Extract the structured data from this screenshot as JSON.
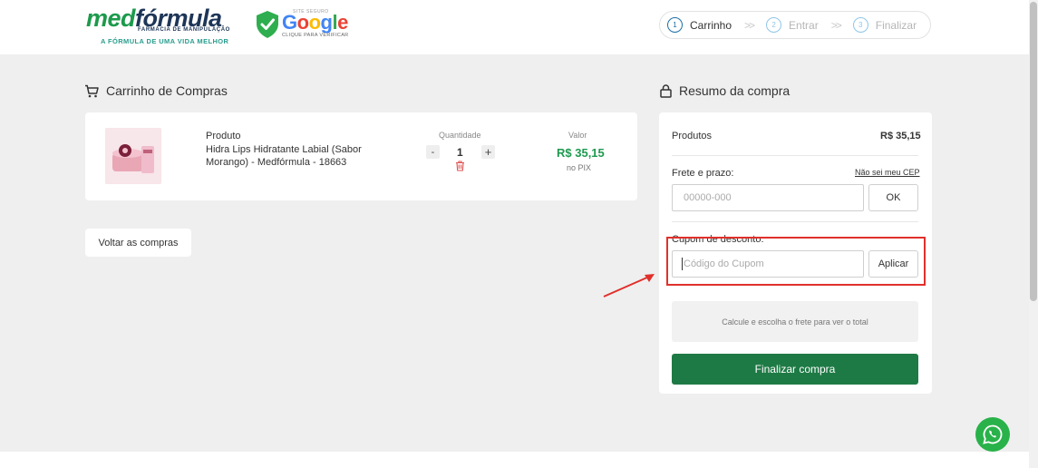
{
  "header": {
    "logo": {
      "word_part1": "med",
      "word_part2": "fórmula",
      "tagline_top": "FARMÁCIA DE MANIPULAÇÃO",
      "tagline_bottom": "A FÓRMULA DE UMA VIDA MELHOR"
    },
    "security_badge": {
      "small": "SITE SEGURO",
      "brand_letters": [
        "G",
        "o",
        "o",
        "g",
        "l",
        "e"
      ],
      "cta": "CLIQUE PARA VERIFICAR"
    },
    "steps": [
      {
        "num": "1",
        "label": "Carrinho",
        "active": true
      },
      {
        "num": "2",
        "label": "Entrar",
        "active": false
      },
      {
        "num": "3",
        "label": "Finalizar",
        "active": false
      }
    ],
    "step_separator": ">>"
  },
  "cart": {
    "title": "Carrinho de Compras",
    "product_label": "Produto",
    "product_name": "Hidra Lips Hidratante Labial (Sabor Morango) - Medfórmula - 18663",
    "qty_label": "Quantidade",
    "qty_minus": "-",
    "qty_value": "1",
    "qty_plus": "+",
    "value_label": "Valor",
    "price": "R$ 35,15",
    "price_note": "no PIX",
    "back_button": "Voltar as compras"
  },
  "summary": {
    "title": "Resumo da compra",
    "products_label": "Produtos",
    "products_value": "R$ 35,15",
    "shipping_label": "Frete e prazo:",
    "cep_link": "Não sei meu CEP",
    "cep_placeholder": "00000-000",
    "cep_button": "OK",
    "coupon_label": "Cupom de desconto:",
    "coupon_placeholder": "Código do Cupom",
    "coupon_button": "Aplicar",
    "calc_note": "Calcule e escolha o frete para ver o total",
    "finalize_button": "Finalizar compra"
  },
  "colors": {
    "brand_green": "#1d9a4c",
    "brand_navy": "#1d3557",
    "price_green": "#1e9a4f",
    "finalize_green": "#1e7a45",
    "highlight_red": "#e0302b",
    "whatsapp_green": "#29b24a"
  },
  "icons": [
    "verified-shield-icon",
    "cart-icon",
    "lock-icon",
    "trash-icon",
    "whatsapp-icon",
    "annotation-arrow"
  ]
}
